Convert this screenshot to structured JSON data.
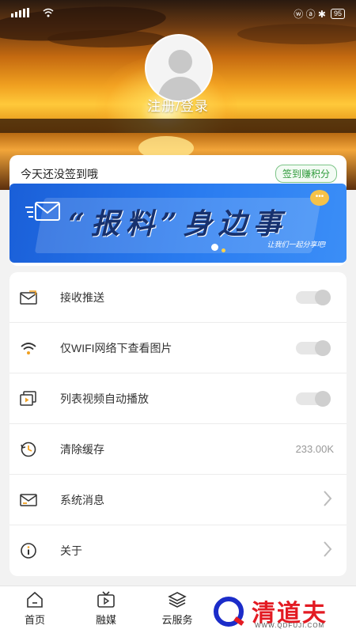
{
  "status_bar": {
    "right_text": "ⓦ ⓐ ✱",
    "battery": "95"
  },
  "profile": {
    "login_label": "注册/登录"
  },
  "sign_in": {
    "prompt": "今天还没签到哦",
    "button_label": "签到赚积分"
  },
  "banner": {
    "title": "“报料”身边事",
    "subtitle": "让我们一起分享吧!"
  },
  "settings": {
    "items": [
      {
        "icon": "envelope-icon",
        "label": "接收推送",
        "type": "toggle",
        "on": false
      },
      {
        "icon": "wifi-icon",
        "label": "仅WIFI网络下查看图片",
        "type": "toggle",
        "on": false
      },
      {
        "icon": "video-play-icon",
        "label": "列表视频自动播放",
        "type": "toggle",
        "on": false
      },
      {
        "icon": "clock-clear-icon",
        "label": "清除缓存",
        "type": "value",
        "value": "233.00K"
      },
      {
        "icon": "message-icon",
        "label": "系统消息",
        "type": "link"
      },
      {
        "icon": "info-icon",
        "label": "关于",
        "type": "link"
      }
    ]
  },
  "bottom_nav": {
    "items": [
      {
        "icon": "home-icon",
        "label": "首页"
      },
      {
        "icon": "tv-icon",
        "label": "融媒"
      },
      {
        "icon": "layers-icon",
        "label": "云服务"
      }
    ]
  },
  "watermark": {
    "name": "清道夫",
    "url": "WWW.QDFUJI.COM"
  },
  "colors": {
    "accent_green": "#2e9a3a",
    "banner_blue": "#2a7cf0"
  }
}
